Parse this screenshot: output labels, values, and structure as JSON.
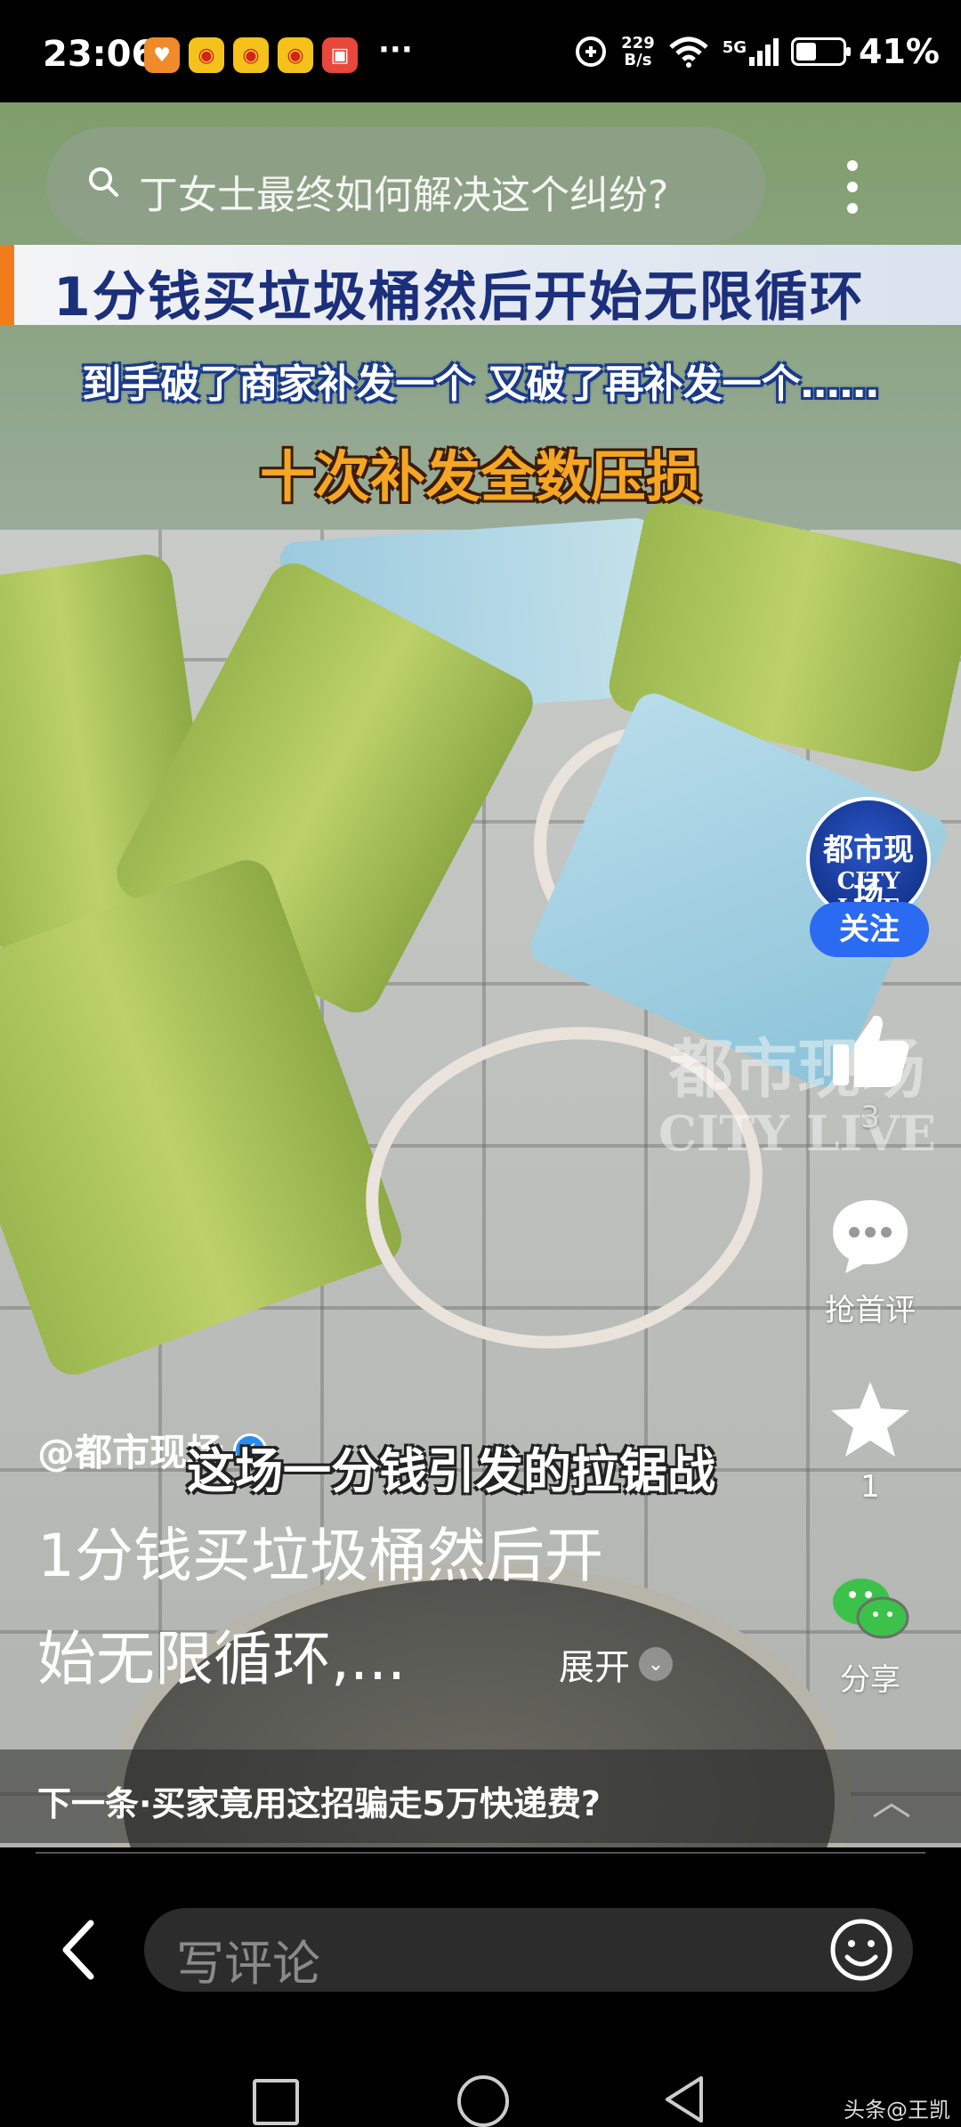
{
  "status_bar": {
    "time": "23:06",
    "dots": "···",
    "net_speed_value": "229",
    "net_speed_unit": "B/s",
    "signal": "5G",
    "battery": "41%"
  },
  "search": {
    "placeholder": "丁女士最终如何解决这个纠纷?"
  },
  "video": {
    "banner_title": "1分钱买垃圾桶然后开始无限循环",
    "banner_sub": "到手破了商家补发一个 又破了再补发一个……",
    "banner_highlight": "十次补发全数压损",
    "subtitle": "这场一分钱引发的拉锯战",
    "watermark_line1": "都市现场",
    "watermark_line2": "CITY LIVE"
  },
  "channel": {
    "avatar_line1": "都市现场",
    "avatar_line2": "CITY LIVE",
    "follow_label": "关注"
  },
  "actions": {
    "like_count": "3",
    "comment_label": "抢首评",
    "favorite_count": "1",
    "share_label": "分享"
  },
  "post": {
    "author": "@都市现场",
    "caption_line1": "1分钱买垃圾桶然后开",
    "caption_line2": "始无限循环,...",
    "expand_label": "展开"
  },
  "next": {
    "label": "下一条·买家竟用这招骗走5万快递费?"
  },
  "comment_bar": {
    "placeholder": "写评论"
  },
  "corner_watermark": "头条@王凯",
  "colors": {
    "follow_blue": "#2a6bf2",
    "banner_navy": "#1b2f7b",
    "highlight_orange": "#f5a623",
    "share_green": "#3cc24a"
  }
}
